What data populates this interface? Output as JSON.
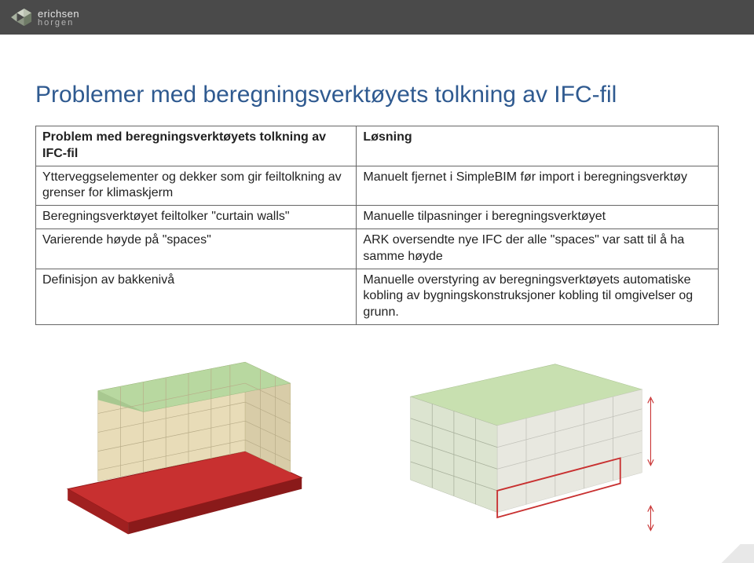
{
  "brand": {
    "name": "erichsen",
    "sub": "horgen"
  },
  "title": "Problemer med beregningsverktøyets tolkning av IFC-fil",
  "table": {
    "header": {
      "left": "Problem med beregningsverktøyets tolkning av IFC-fil",
      "right": "Løsning"
    },
    "rows": [
      {
        "left": "Ytterveggselementer og dekker som gir feiltolkning av grenser for klimaskjerm",
        "right": "Manuelt fjernet i SimpleBIM før import i beregningsverktøy"
      },
      {
        "left": "Beregningsverktøyet feiltolker \"curtain walls\"",
        "right": "Manuelle tilpasninger i beregningsverktøyet"
      },
      {
        "left": "Varierende høyde på \"spaces\"",
        "right": "ARK oversendte nye IFC der alle \"spaces\" var satt til å ha samme høyde"
      },
      {
        "left": "Definisjon av bakkenivå",
        "right": "Manuelle overstyring av beregningsverktøyets automatiske kobling av bygningskonstruksjoner kobling til omgivelser og grunn."
      }
    ]
  }
}
